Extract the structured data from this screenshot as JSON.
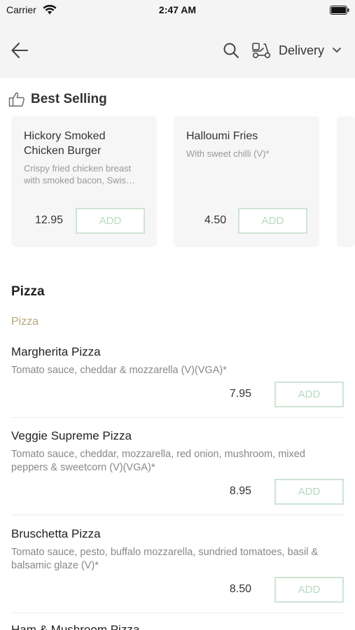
{
  "status_bar": {
    "carrier": "Carrier",
    "time": "2:47 AM"
  },
  "header": {
    "back_icon": "arrow-left-icon",
    "search_icon": "search-icon",
    "delivery_icon": "scooter-icon",
    "delivery_label": "Delivery",
    "dropdown_icon": "chevron-down-icon"
  },
  "best_selling": {
    "title": "Best Selling",
    "icon": "thumbs-up-icon",
    "cards": [
      {
        "name": "Hickory Smoked Chicken Burger",
        "description": "Crispy fried chicken breast with smoked bacon, Swis…",
        "price": "12.95",
        "add_label": "ADD"
      },
      {
        "name": "Halloumi Fries",
        "description": "With sweet chilli (V)*",
        "price": "4.50",
        "add_label": "ADD"
      }
    ]
  },
  "menu": {
    "section_title": "Pizza",
    "subcategory": "Pizza",
    "items": [
      {
        "name": "Margherita Pizza",
        "description": "Tomato sauce, cheddar & mozzarella (V)(VGA)*",
        "price": "7.95",
        "add_label": "ADD"
      },
      {
        "name": "Veggie Supreme Pizza",
        "description": "Tomato sauce, cheddar, mozzarella, red onion, mushroom, mixed peppers & sweetcorn (V)(VGA)*",
        "price": "8.95",
        "add_label": "ADD"
      },
      {
        "name": "Bruschetta Pizza",
        "description": "Tomato sauce, pesto, buffalo mozzarella, sundried tomatoes, basil & balsamic glaze (V)*",
        "price": "8.50",
        "add_label": "ADD"
      },
      {
        "name": "Ham & Mushroom Pizza"
      }
    ]
  },
  "colors": {
    "header_bg": "#f4f4f4",
    "card_bg": "#f6f6f6",
    "add_border": "#cfe4d4",
    "add_text": "#b8d8c1",
    "subcategory": "#b8a57a"
  }
}
